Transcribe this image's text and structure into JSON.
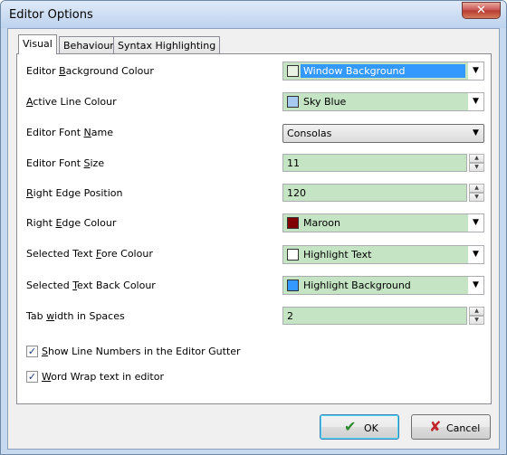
{
  "window": {
    "title": "Editor Options",
    "close_glyph": "✕"
  },
  "tabs": [
    {
      "label": "Visual",
      "active": true
    },
    {
      "label": "Behaviour",
      "active": false
    },
    {
      "label": "Syntax Highlighting",
      "active": false
    }
  ],
  "settings": {
    "editor_background_colour": {
      "label_pre": "Editor ",
      "label_key": "B",
      "label_post": "ackground Colour",
      "value": "Window Background",
      "swatch": "#e9f3e3"
    },
    "active_line_colour": {
      "label_pre": "",
      "label_key": "A",
      "label_post": "ctive Line Colour",
      "value": "Sky Blue",
      "swatch": "#a6caf0"
    },
    "editor_font_name": {
      "label_pre": "Editor Font ",
      "label_key": "N",
      "label_post": "ame",
      "value": "Consolas"
    },
    "editor_font_size": {
      "label_pre": "Editor Font ",
      "label_key": "S",
      "label_post": "ize",
      "value": "11"
    },
    "right_edge_position": {
      "label_pre": "",
      "label_key": "R",
      "label_post": "ight Edge Position",
      "value": "120"
    },
    "right_edge_colour": {
      "label_pre": "Right ",
      "label_key": "E",
      "label_post": "dge Colour",
      "value": "Maroon",
      "swatch": "#800000"
    },
    "selected_text_fore_colour": {
      "label_pre": "Selected Text ",
      "label_key": "F",
      "label_post": "ore Colour",
      "value": "Highlight Text",
      "swatch": "#ffffff"
    },
    "selected_text_back_colour": {
      "label_pre": "Selected ",
      "label_key": "T",
      "label_post": "ext Back Colour",
      "value": "Highlight Background",
      "swatch": "#3399ff"
    },
    "tab_width": {
      "label_pre": "Tab ",
      "label_key": "w",
      "label_post": "idth in Spaces",
      "value": "2"
    }
  },
  "checkboxes": {
    "show_line_numbers": {
      "key": "S",
      "label": "how Line Numbers in the Editor Gutter",
      "checked": true,
      "mark": "✓"
    },
    "word_wrap": {
      "key": "W",
      "label": "ord Wrap text in editor",
      "checked": true,
      "mark": "✓"
    }
  },
  "buttons": {
    "ok": {
      "label": "OK",
      "icon": "checkmark-icon",
      "glyph": "✔"
    },
    "cancel": {
      "label": "Cancel",
      "icon": "cross-icon",
      "glyph": "✘"
    }
  },
  "icons": {
    "dropdown": "▼",
    "spin_up": "▲",
    "spin_down": "▼"
  },
  "colors": {
    "field_bg": "#c4e4c4",
    "selection": "#3399ff",
    "ok_icon": "#2e8b2e",
    "cancel_icon": "#c0272d"
  }
}
